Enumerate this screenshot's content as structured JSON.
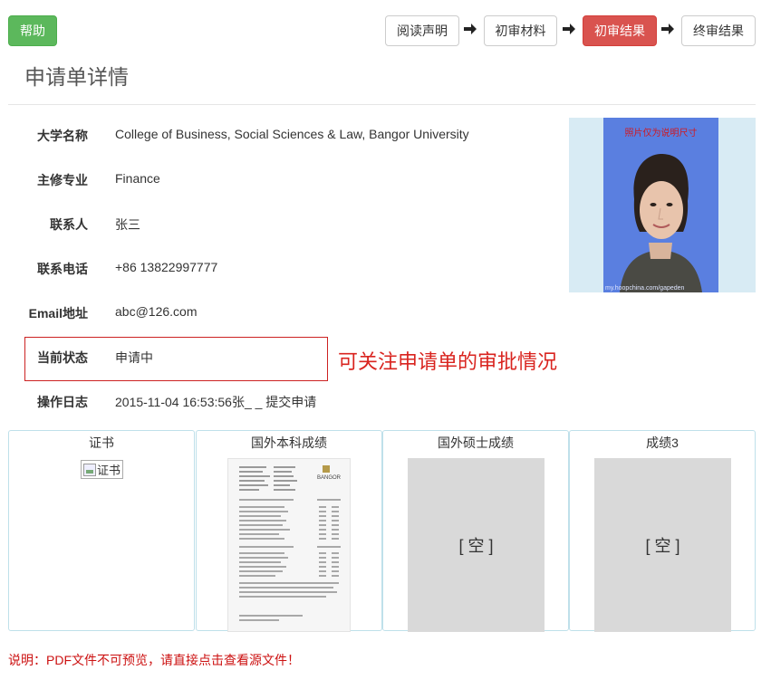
{
  "toolbar": {
    "help_label": "帮助",
    "steps": [
      {
        "label": "阅读声明",
        "active": false
      },
      {
        "label": "初审材料",
        "active": false
      },
      {
        "label": "初审结果",
        "active": true
      },
      {
        "label": "终审结果",
        "active": false
      }
    ]
  },
  "page": {
    "title": "申请单详情"
  },
  "details": [
    {
      "label": "大学名称",
      "value": "College of Business, Social Sciences & Law, Bangor University"
    },
    {
      "label": "主修专业",
      "value": "Finance"
    },
    {
      "label": "联系人",
      "value": "张三"
    },
    {
      "label": "联系电话",
      "value": "+86 13822997777"
    },
    {
      "label": "Email地址",
      "value": "abc@126.com"
    },
    {
      "label": "当前状态",
      "value": "申请中"
    },
    {
      "label": "操作日志",
      "value": "2015-11-04 16:53:56张_ _ 提交申请"
    }
  ],
  "annotation": "可关注申请单的审批情况",
  "photo": {
    "caption": "照片仅为说明尺寸",
    "watermark": "my.hoopchina.com/gapeden"
  },
  "documents": [
    {
      "title": "证书",
      "alt": "证书"
    },
    {
      "title": "国外本科成绩",
      "doc_header": "BANGOR"
    },
    {
      "title": "国外硕士成绩",
      "placeholder": "[ 空 ]"
    },
    {
      "title": "成绩3",
      "placeholder": "[ 空 ]"
    }
  ],
  "note": "说明：PDF文件不可预览，请直接点击查看源文件！",
  "colors": {
    "help_green": "#5cb85c",
    "active_red": "#d9534f",
    "annotation_red": "#d9241f",
    "photo_bg": "#5a7fe0"
  }
}
